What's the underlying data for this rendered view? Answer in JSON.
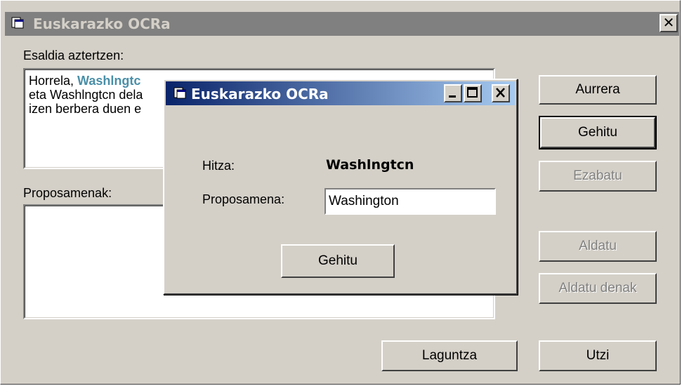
{
  "main": {
    "title": "Euskarazko OCRa",
    "close_glyph": "✕",
    "sentence_label": "Esaldia aztertzen:",
    "sentence": {
      "line1_prefix": "Horrela, ",
      "line1_word": "Washlngtc",
      "line2": "eta Washlngtcn dela",
      "line3": "izen berbera duen e"
    },
    "proposals_label": "Proposamenak:",
    "buttons": {
      "next": "Aurrera",
      "add": "Gehitu",
      "delete": "Ezabatu",
      "change": "Aldatu",
      "change_all": "Aldatu denak",
      "help": "Laguntza",
      "quit": "Utzi"
    }
  },
  "dialog": {
    "title": "Euskarazko OCRa",
    "word_label": "Hitza:",
    "word_value": "Washlngtcn",
    "proposal_label": "Proposamena:",
    "proposal_value": "Washington",
    "add_button": "Gehitu"
  },
  "icons": {
    "app_icon": "document-window-icon",
    "minimize": "minimize-icon",
    "maximize": "maximize-icon",
    "close": "close-icon"
  },
  "colors": {
    "dialog_title_start": "#0a246a",
    "dialog_title_end": "#a6caf0",
    "highlight_word": "#4a8fa8",
    "inactive_title": "#808080"
  }
}
